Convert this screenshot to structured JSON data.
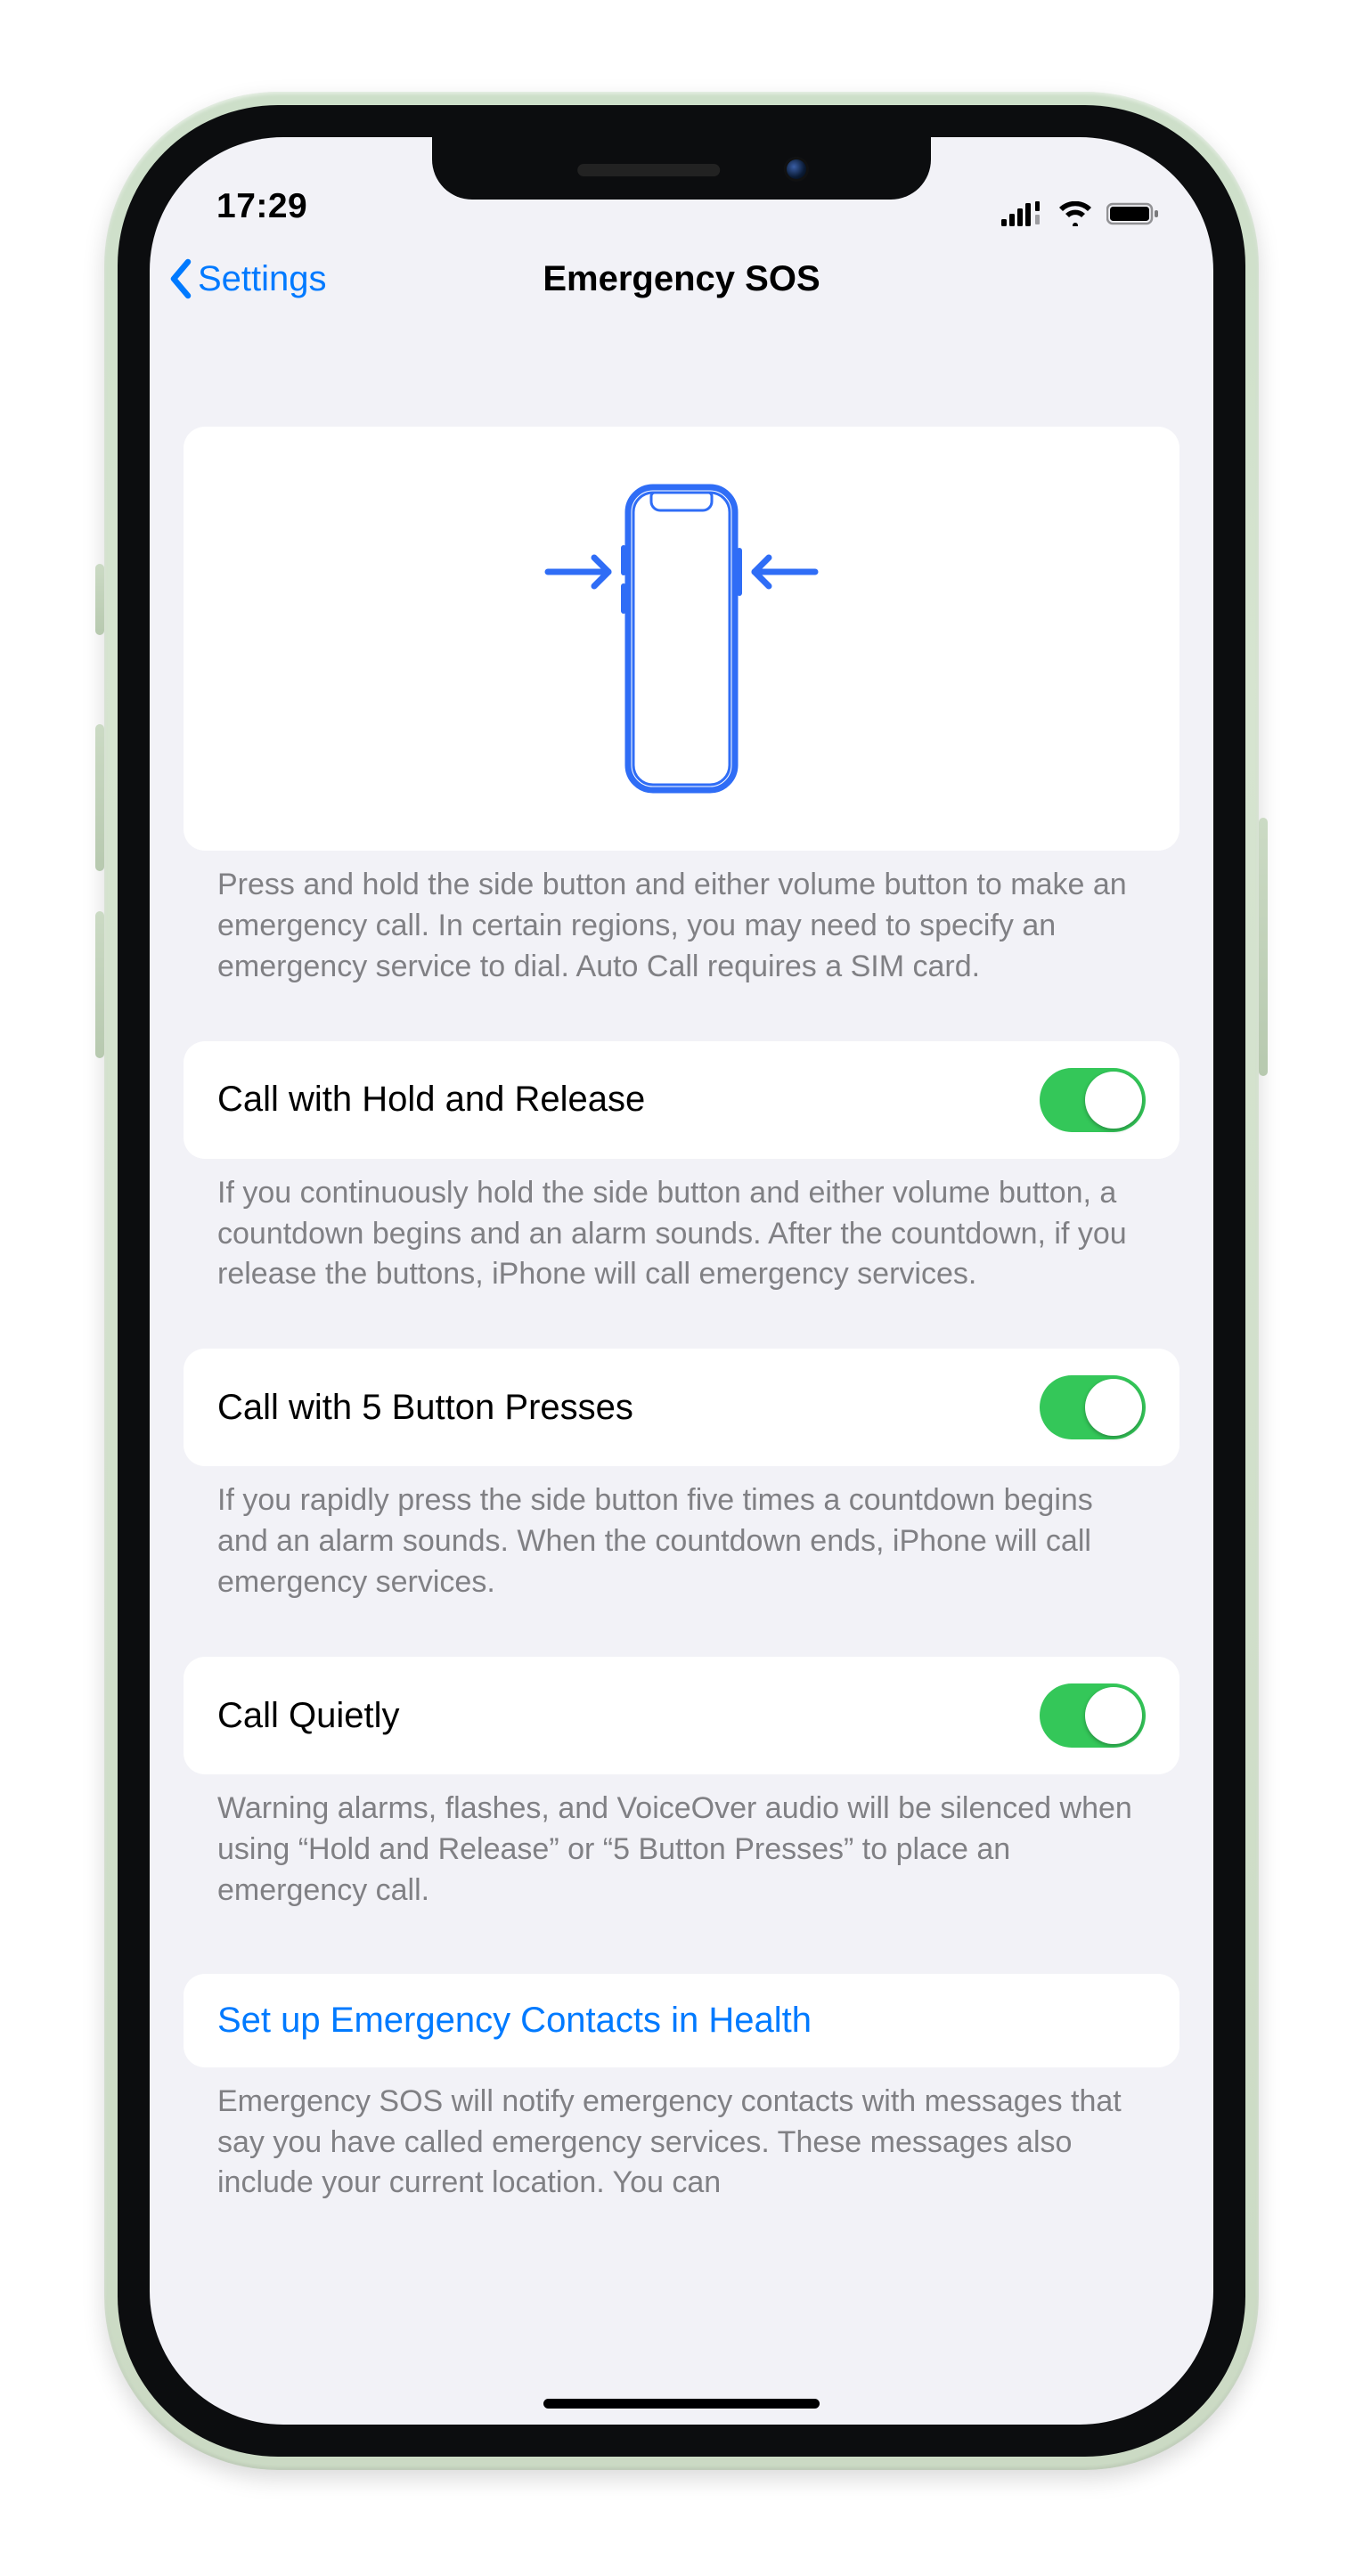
{
  "status": {
    "time": "17:29",
    "cellular_icon": "cellular-dual-icon",
    "wifi_icon": "wifi-icon",
    "battery_icon": "battery-icon"
  },
  "nav": {
    "back_label": "Settings",
    "title": "Emergency SOS"
  },
  "intro_footer": "Press and hold the side button and either volume button to make an emergency call. In certain regions, you may need to specify an emergency service to dial. Auto Call requires a SIM card.",
  "settings": [
    {
      "label": "Call with Hold and Release",
      "on": true,
      "footer": "If you continuously hold the side button and either volume button, a countdown begins and an alarm sounds. After the countdown, if you release the buttons, iPhone will call emergency services."
    },
    {
      "label": "Call with 5 Button Presses",
      "on": true,
      "footer": "If you rapidly press the side button five times a countdown begins and an alarm sounds. When the countdown ends, iPhone will call emergency services."
    },
    {
      "label": "Call Quietly",
      "on": true,
      "footer": "Warning alarms, flashes, and VoiceOver audio will be silenced when using “Hold and Release” or “5 Button Presses” to place an emergency call."
    }
  ],
  "contacts_link": "Set up Emergency Contacts in Health",
  "contacts_footer": "Emergency SOS will notify emergency contacts with messages that say you have called emergency services. These messages also include your current location. You can",
  "colors": {
    "tint": "#007aff",
    "toggle_on": "#34c759",
    "bg": "#f2f2f7",
    "footer_text": "#808084"
  }
}
